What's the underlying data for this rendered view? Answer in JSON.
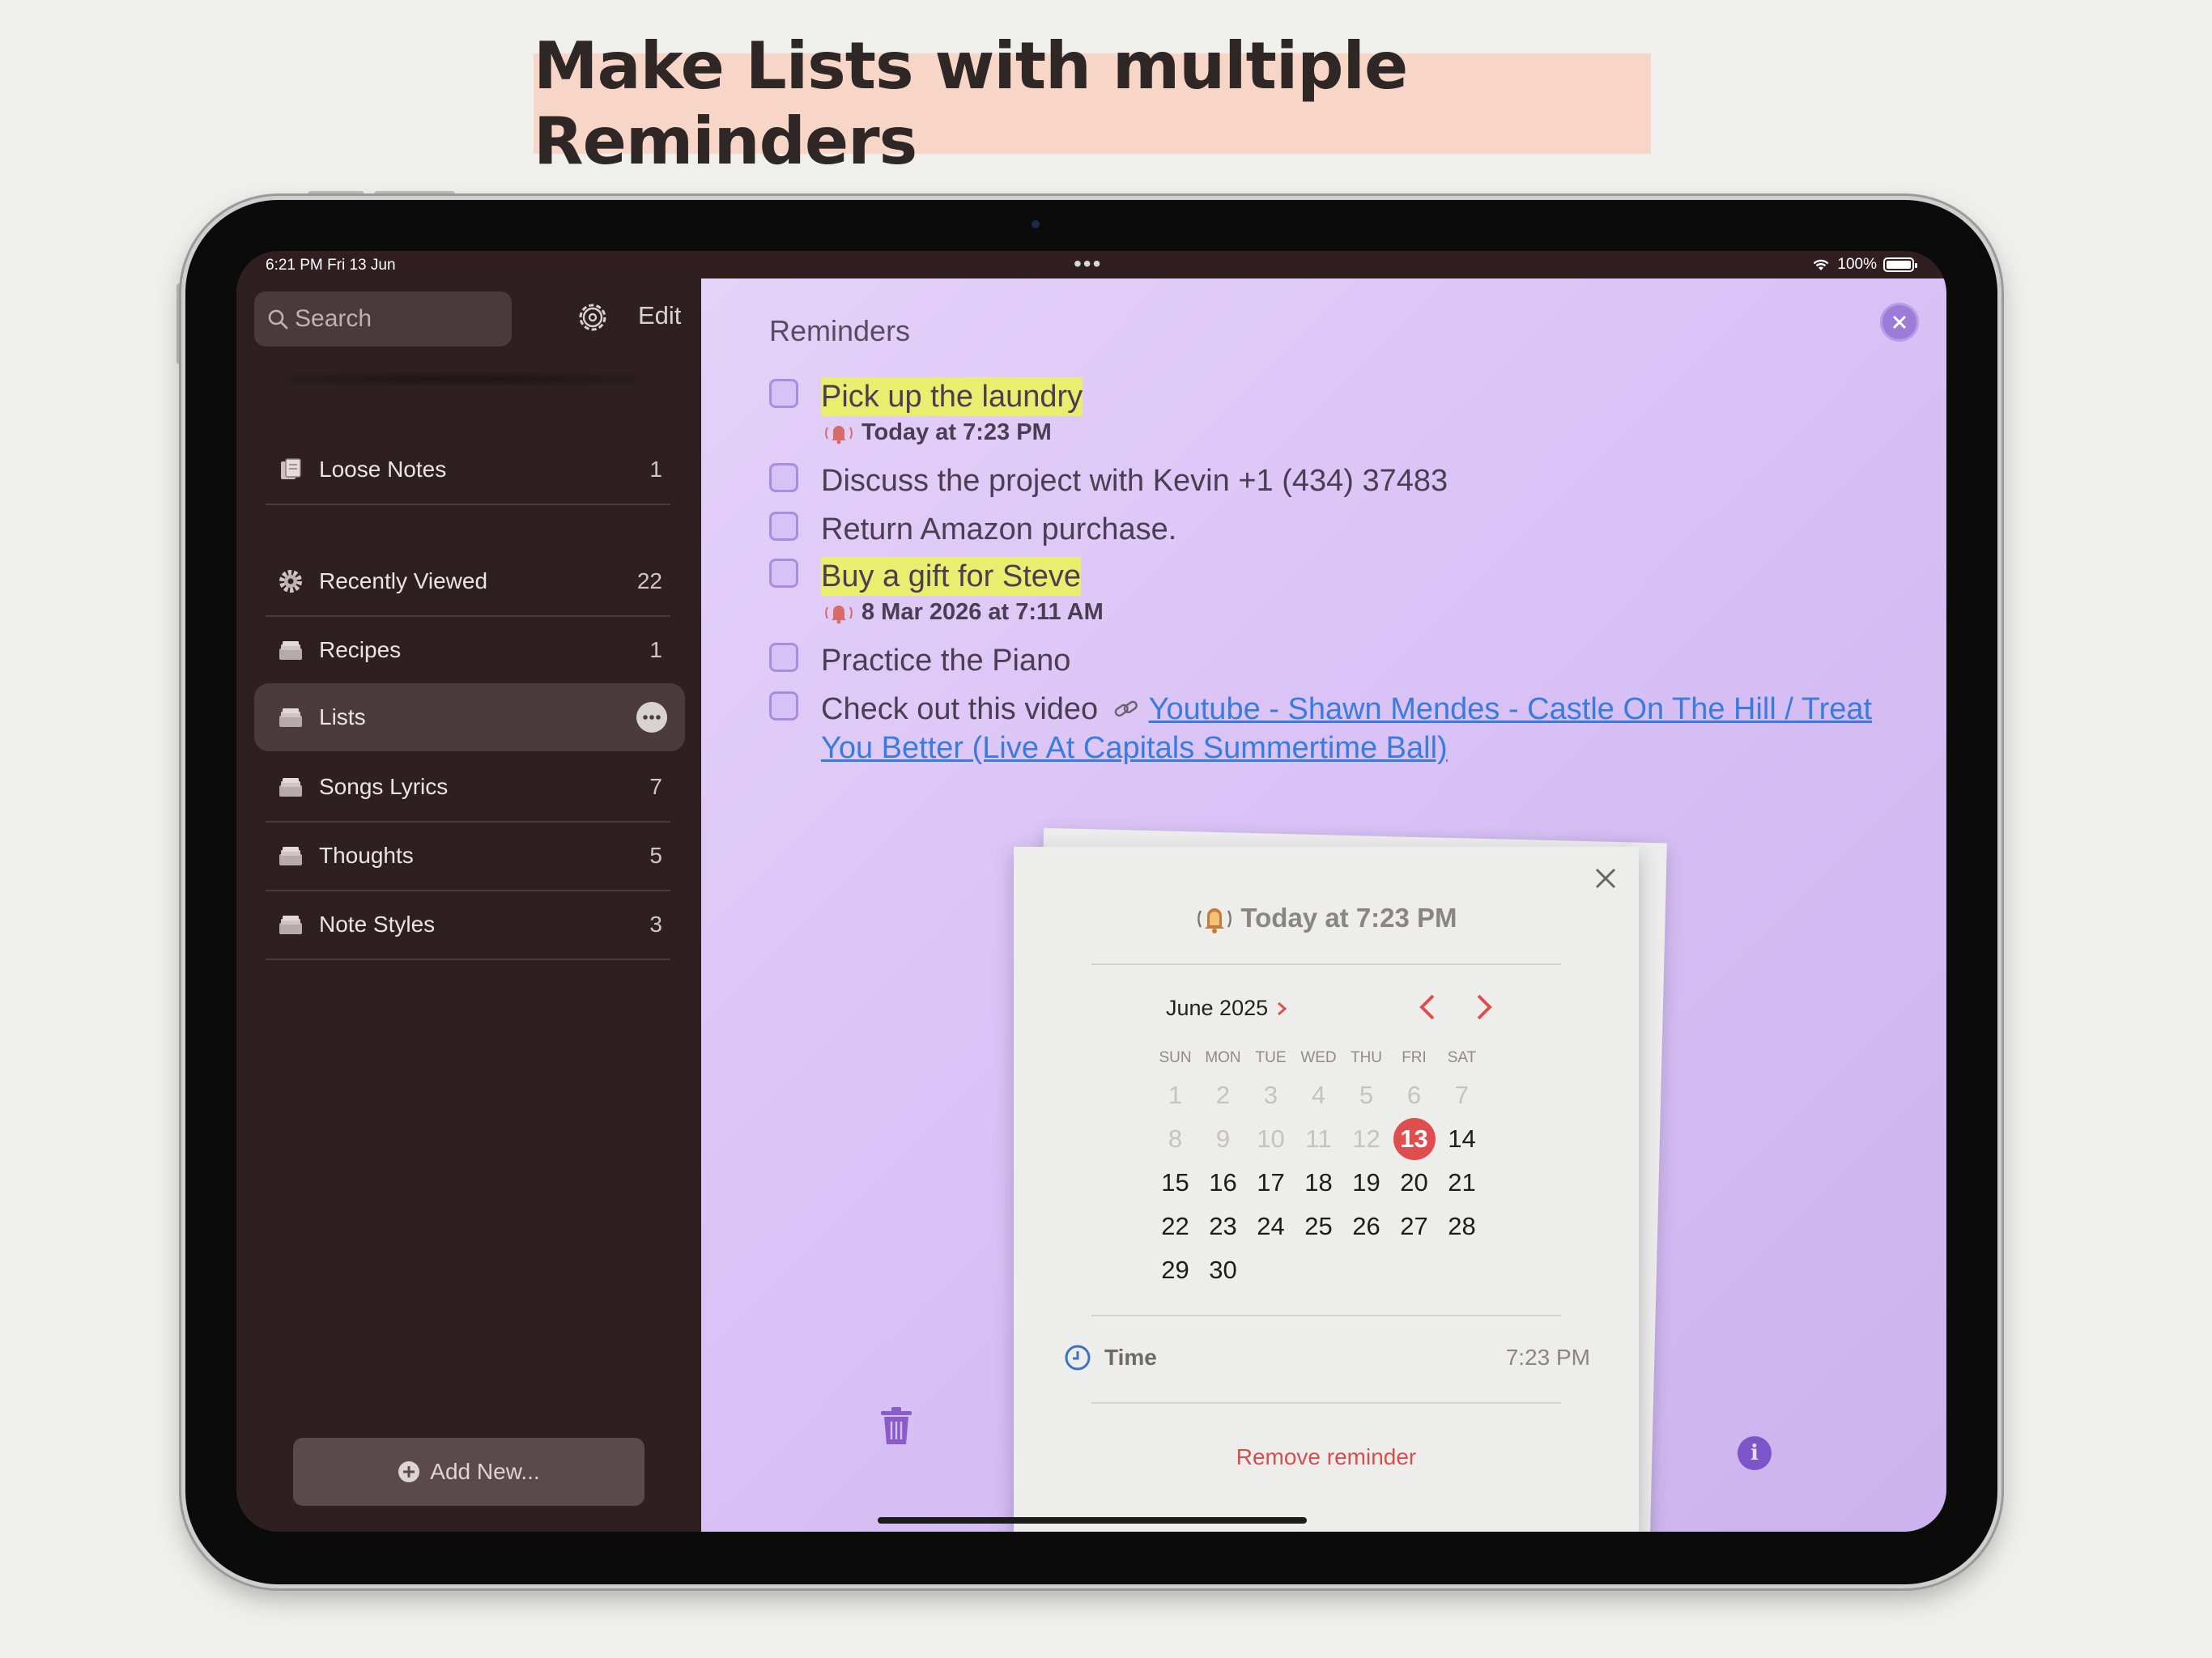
{
  "headline": "Make Lists with multiple Reminders",
  "status": {
    "time": "6:21 PM   Fri 13 Jun",
    "dots": "•••",
    "battery": "100%"
  },
  "sidebar": {
    "search_placeholder": "Search",
    "edit_label": "Edit",
    "items": [
      {
        "label": "Loose Notes",
        "count": "1",
        "icon": "loose-notes-icon"
      },
      {
        "label": "Recently Viewed",
        "count": "22",
        "icon": "gear-icon"
      },
      {
        "label": "Recipes",
        "count": "1",
        "icon": "notebook-icon"
      },
      {
        "label": "Lists",
        "count": "",
        "icon": "notebook-icon",
        "selected": true
      },
      {
        "label": "Songs Lyrics",
        "count": "7",
        "icon": "notebook-icon"
      },
      {
        "label": "Thoughts",
        "count": "5",
        "icon": "notebook-icon"
      },
      {
        "label": "Note Styles",
        "count": "3",
        "icon": "notebook-icon"
      }
    ],
    "add_label": "Add New..."
  },
  "main": {
    "title": "Reminders",
    "tasks": [
      {
        "text": "Pick up the laundry",
        "highlight": true,
        "reminder": "Today at 7:23 PM"
      },
      {
        "text": "Discuss the project with Kevin +1 (434) 37483"
      },
      {
        "text": "Return Amazon purchase."
      },
      {
        "text": "Buy a gift for Steve",
        "highlight": true,
        "reminder": "8 Mar 2026 at 7:11 AM"
      },
      {
        "text": "Practice the Piano"
      },
      {
        "text": "Check out this video",
        "link_line1": "Youtube - Shawn Mendes - Castle On The Hill / Treat",
        "link_line2": "You Better (Live At Capitals Summertime Ball)"
      }
    ]
  },
  "popup": {
    "title": "Today at 7:23 PM",
    "month": "June 2025",
    "weekdays": [
      "SUN",
      "MON",
      "TUE",
      "WED",
      "THU",
      "FRI",
      "SAT"
    ],
    "days": [
      "1",
      "2",
      "3",
      "4",
      "5",
      "6",
      "7",
      "8",
      "9",
      "10",
      "11",
      "12",
      "13",
      "14",
      "15",
      "16",
      "17",
      "18",
      "19",
      "20",
      "21",
      "22",
      "23",
      "24",
      "25",
      "26",
      "27",
      "28",
      "29",
      "30"
    ],
    "selected_day": "13",
    "time_label": "Time",
    "time_value": "7:23 PM",
    "remove_label": "Remove reminder"
  },
  "colors": {
    "accent_red": "#e04d4f",
    "link": "#3a7bde",
    "highlight": "#e9ee6e",
    "purple": "#9d7bd8"
  }
}
